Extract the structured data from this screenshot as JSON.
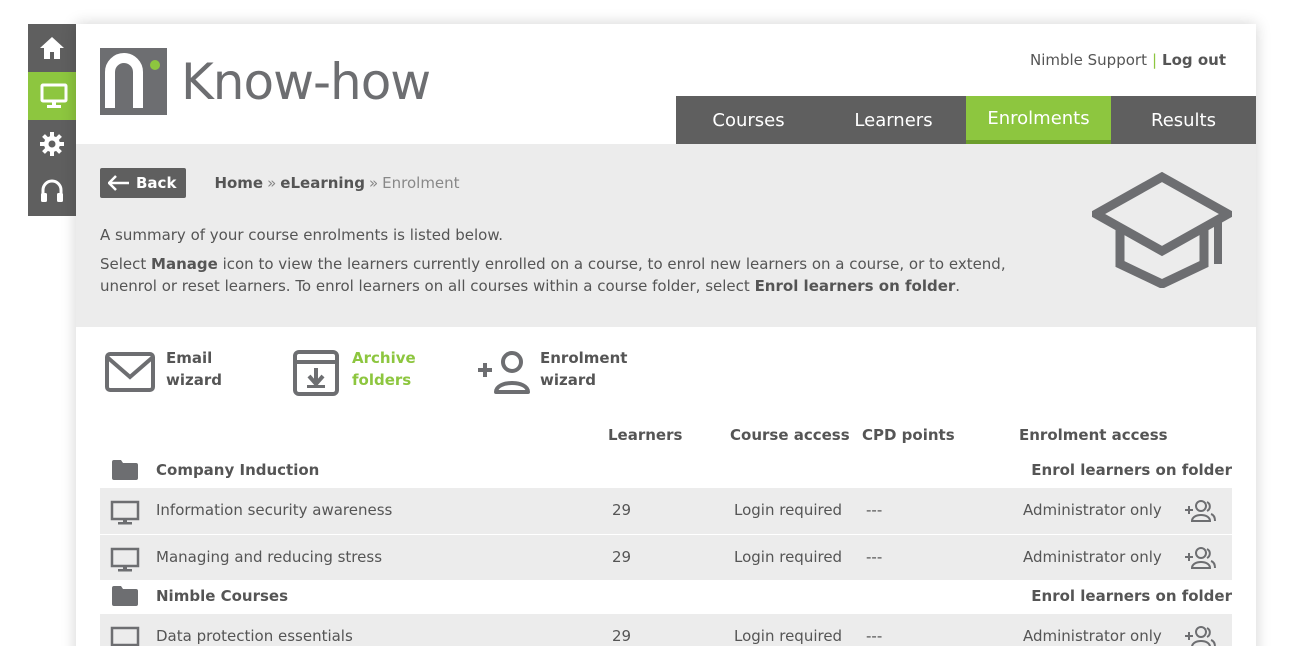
{
  "rail": {
    "items": [
      {
        "icon": "home-icon"
      },
      {
        "icon": "monitor-icon",
        "active": true
      },
      {
        "icon": "gear-icon"
      },
      {
        "icon": "headset-icon"
      }
    ]
  },
  "header": {
    "logo_text": "Know-how",
    "support_link": "Nimble Support",
    "separator": "|",
    "logout_link": "Log out"
  },
  "nav": {
    "tabs": [
      {
        "label": "Courses"
      },
      {
        "label": "Learners"
      },
      {
        "label": "Enrolments",
        "active": true
      },
      {
        "label": "Results"
      }
    ]
  },
  "breadcrumb": {
    "back_label": "Back",
    "home": "Home",
    "elearning": "eLearning",
    "current": "Enrolment",
    "sep": "»"
  },
  "intro": {
    "line1": "A summary of your course enrolments is listed below.",
    "line2_pre": "Select ",
    "line2_manage": "Manage",
    "line2_mid": " icon to view the learners currently enrolled on a course, to enrol new learners on a course, or to extend, unenrol or reset learners. To enrol learners on all courses within a course folder, select ",
    "line2_enrol": "Enrol learners on folder",
    "line2_end": "."
  },
  "tools": {
    "email_line1": "Email",
    "email_line2": "wizard",
    "archive_line1": "Archive",
    "archive_line2": "folders",
    "enrolment_line1": "Enrolment",
    "enrolment_line2": "wizard"
  },
  "table": {
    "headers": {
      "learners": "Learners",
      "course_access": "Course access",
      "cpd_points": "CPD points",
      "enrolment_access": "Enrolment access"
    },
    "folders": [
      {
        "name": "Company Induction",
        "enrol_label": "Enrol learners on folder",
        "courses": [
          {
            "name": "Information security awareness",
            "learners": "29",
            "access": "Login required",
            "cpd": "---",
            "enrolment": "Administrator only"
          },
          {
            "name": "Managing and reducing stress",
            "learners": "29",
            "access": "Login required",
            "cpd": "---",
            "enrolment": "Administrator only"
          }
        ]
      },
      {
        "name": "Nimble Courses",
        "enrol_label": "Enrol learners on folder",
        "courses": [
          {
            "name": "Data protection essentials",
            "learners": "29",
            "access": "Login required",
            "cpd": "---",
            "enrolment": "Administrator only"
          }
        ]
      }
    ]
  },
  "colors": {
    "accent": "#8dc63f",
    "dark": "#5f5f5f",
    "panel": "#ececec",
    "text": "#555555"
  }
}
